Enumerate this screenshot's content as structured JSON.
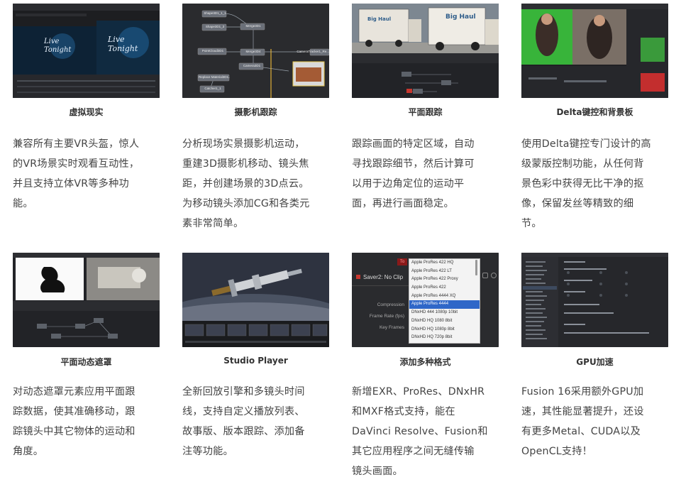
{
  "features": [
    {
      "title": "虚拟现实",
      "lines": [
        "兼容所有主要VR头盔，惊人",
        "的VR场景实时观看互动性，",
        "并且支持立体VR等多种功",
        "能。"
      ],
      "thumb_text": "Live Tonight"
    },
    {
      "title": "摄影机跟踪",
      "lines": [
        "分析现场实景摄影机运动，",
        "重建3D摄影机移动、镜头焦",
        "距，并创建场景的3D点云。",
        "为移动镜头添加CG和各类元",
        "素非常简单。"
      ],
      "nodes": [
        "Shape3D1_1_1",
        "Shape3D1_3",
        "Merge3D1",
        "PointCloud3D1",
        "Merge3D4",
        "CameraTracker1_Re...",
        "Camera3D1",
        "Replace Material3D1...",
        "Catcher1_1"
      ]
    },
    {
      "title": "平面跟踪",
      "lines": [
        "跟踪画面的特定区域，自动",
        "寻找跟踪细节，然后计算可",
        "以用于边角定位的运动平",
        "面，再进行画面稳定。"
      ],
      "truck_text": "Big Haul"
    },
    {
      "title": "Delta键控和背景板",
      "lines": [
        "使用Delta键控专门设计的高",
        "级蒙版控制功能，从任何背",
        "景色彩中获得无比干净的抠",
        "像，保留发丝等精致的细",
        "节。"
      ]
    },
    {
      "title": "平面动态遮罩",
      "lines": [
        "对动态遮罩元素应用平面跟",
        "踪数据，使其准确移动，跟",
        "踪镜头中其它物体的运动和",
        "角度。"
      ]
    },
    {
      "title": "Studio Player",
      "lines": [
        "全新回放引擎和多镜头时间",
        "线，支持自定义播放列表、",
        "故事版、版本跟踪、添加备",
        "注等功能。"
      ]
    },
    {
      "title": "添加多种格式",
      "lines": [
        "新增EXR、ProRes、DNxHR",
        "和MXF格式支持，能在",
        "DaVinci Resolve、Fusion和",
        "其它应用程序之间无缝传输",
        "镜头画面。"
      ],
      "saver_label": "Saver2: No Clip",
      "tab_label": "To",
      "params": [
        "Compression",
        "Frame Rate (fps)",
        "Key Frames"
      ],
      "codecs": [
        "Apple ProRes 422 HQ",
        "Apple ProRes 422 LT",
        "Apple ProRes 422 Proxy",
        "Apple ProRes 422",
        "Apple ProRes 4444 XQ",
        "Apple ProRes 4444",
        "DNxHD 444 1080p 10bit",
        "DNxHD HQ 1080 8bit",
        "DNxHD HQ 1080p 8bit",
        "DNxHD HQ 720p 8bit"
      ],
      "selected_codec": "Apple ProRes 4444"
    },
    {
      "title": "GPU加速",
      "lines": [
        "Fusion 16采用额外GPU加",
        "速，其性能显著提升，还设",
        "有更多Metal、CUDA以及",
        "OpenCL支持！"
      ]
    }
  ],
  "colors": {
    "title": "#333333",
    "text": "#444444",
    "thumb_bg": "#1e1f22",
    "menu_selected": "#2f67c8",
    "green_screen": "#38b43a"
  }
}
